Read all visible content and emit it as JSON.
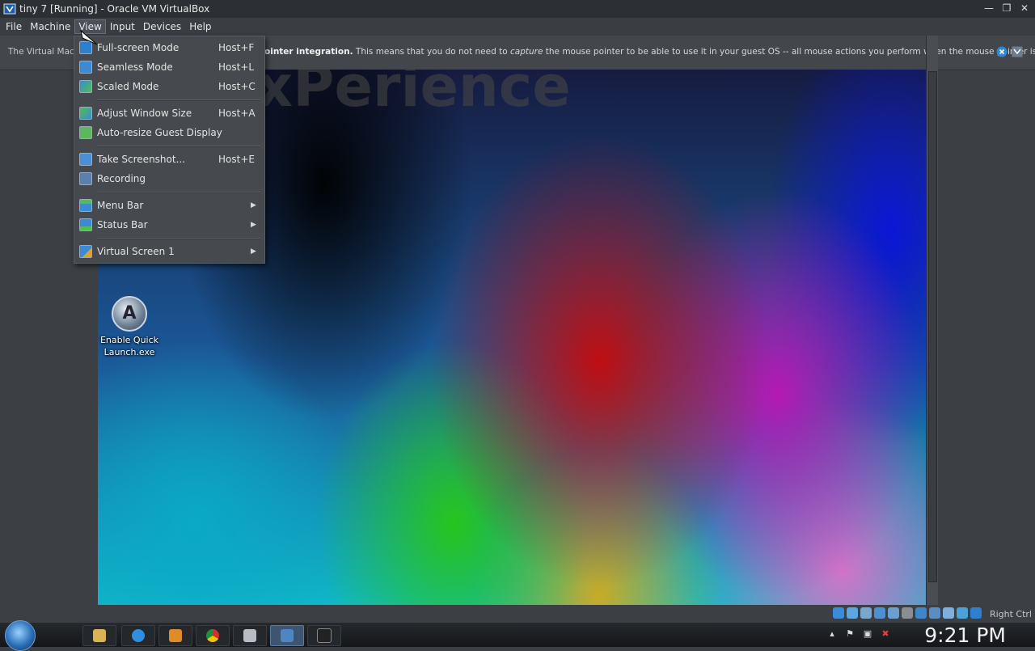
{
  "window": {
    "title": "tiny 7 [Running] - Oracle VM VirtualBox"
  },
  "menubar": {
    "items": [
      {
        "label": "File"
      },
      {
        "label": "Machine"
      },
      {
        "label": "View"
      },
      {
        "label": "Input"
      },
      {
        "label": "Devices"
      },
      {
        "label": "Help"
      }
    ]
  },
  "notice": {
    "text_left": "The Virtual Machi",
    "text_bold": "ointer integration.",
    "text_rest_a": " This means that you do not need to ",
    "text_italic": "capture",
    "text_rest_b": " the mouse pointer to be able to use it in your guest OS -- all mouse actions you perform when the mouse pointer is over"
  },
  "view_menu": {
    "items": [
      {
        "label": "Full-screen Mode",
        "shortcut": "Host+F"
      },
      {
        "label": "Seamless Mode",
        "shortcut": "Host+L"
      },
      {
        "label": "Scaled Mode",
        "shortcut": "Host+C"
      },
      {
        "label": "Adjust Window Size",
        "shortcut": "Host+A"
      },
      {
        "label": "Auto-resize Guest Display",
        "shortcut": ""
      },
      {
        "label": "Take Screenshot...",
        "shortcut": "Host+E"
      },
      {
        "label": "Recording",
        "shortcut": ""
      },
      {
        "label": "Menu Bar",
        "shortcut": ""
      },
      {
        "label": "Status Bar",
        "shortcut": ""
      },
      {
        "label": "Virtual Screen 1",
        "shortcut": ""
      }
    ]
  },
  "guest": {
    "watermark": "xPerience",
    "desktop_icon_label_1": "Enable Quick",
    "desktop_icon_label_2": "Launch.exe",
    "desktop_icon_glyph": "A"
  },
  "statusbar": {
    "host_key": "Right Ctrl"
  },
  "taskbar": {
    "clock": "9:21 PM"
  },
  "colors": {
    "accent": "#3e5572",
    "menu_bg": "#46494e",
    "chrome_bg": "#3c3f44"
  }
}
